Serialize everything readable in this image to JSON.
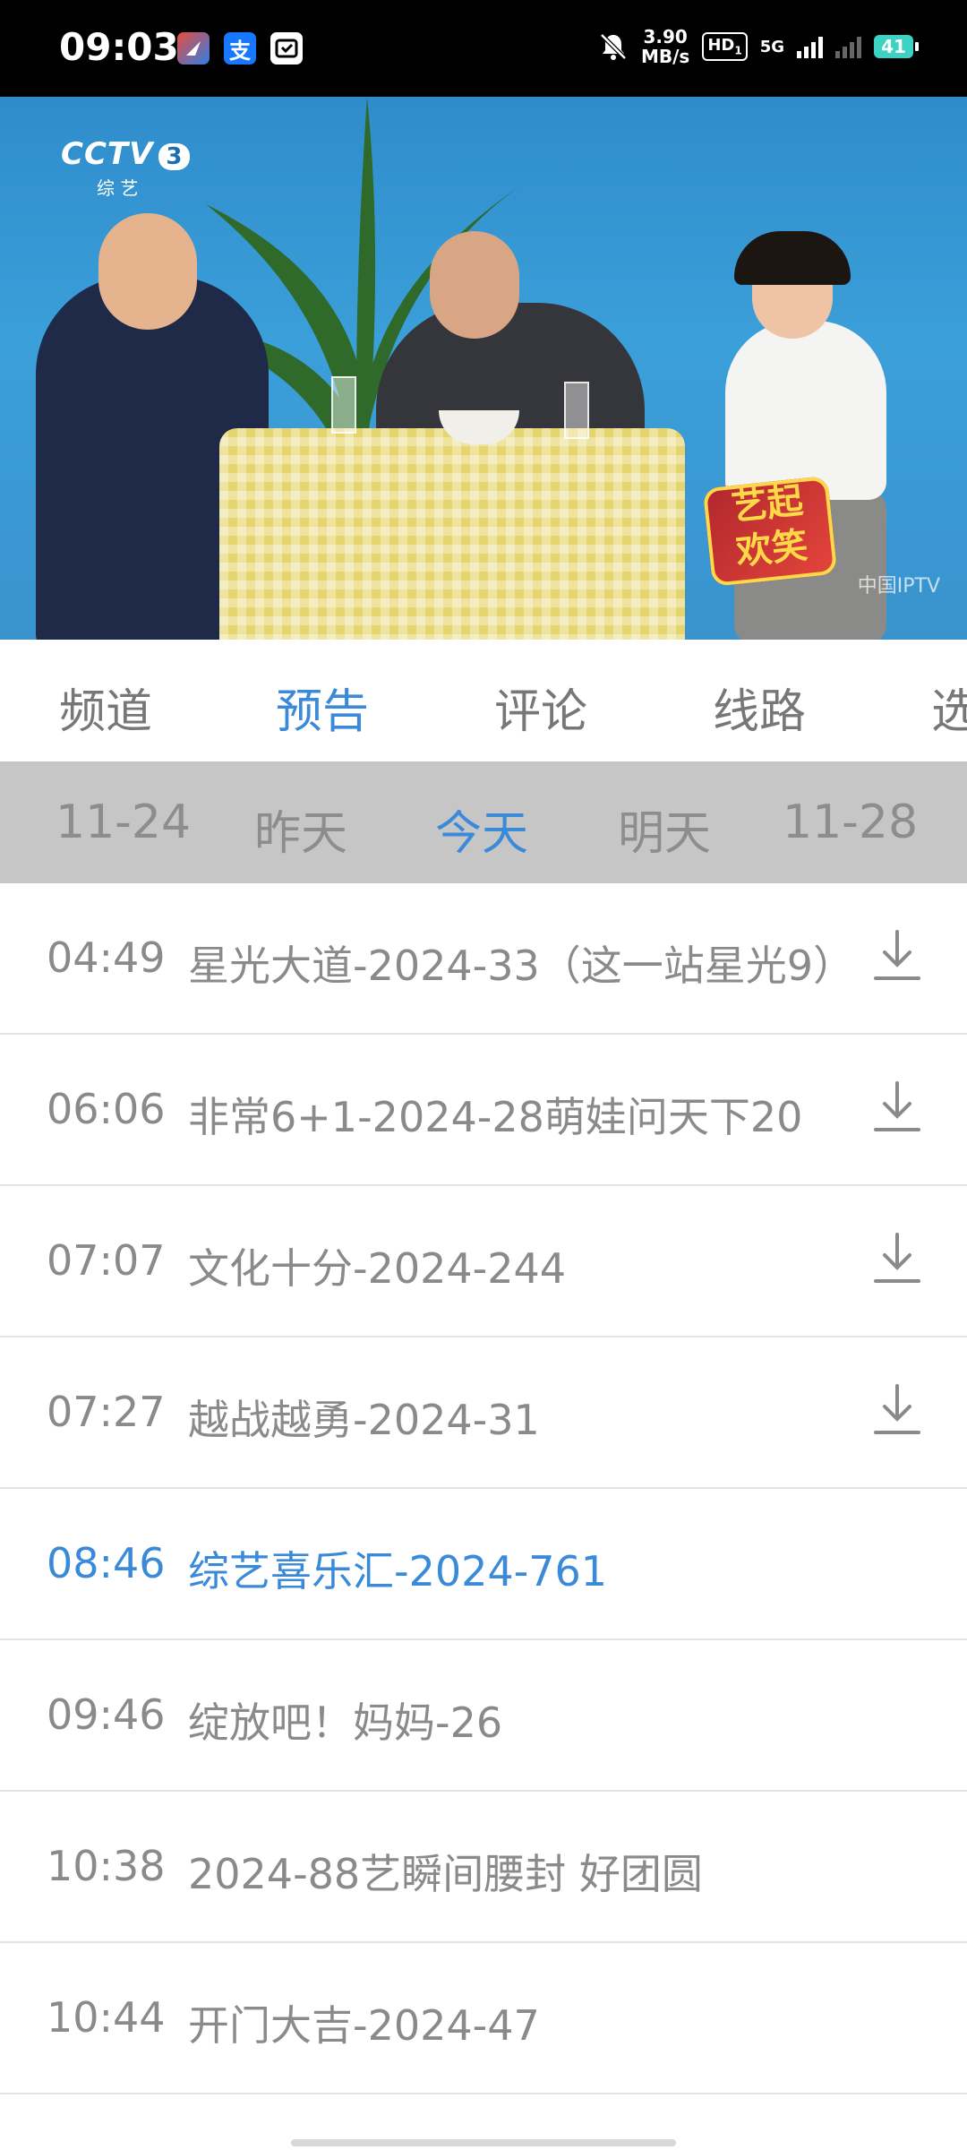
{
  "status_bar": {
    "time": "09:03",
    "net_speed_value": "3.90",
    "net_speed_unit": "MB/s",
    "hd": "HD",
    "hd_sub": "1",
    "network": "5G",
    "battery": "41",
    "app_icons": [
      "browser-app-icon",
      "alipay-app-icon",
      "wallet-app-icon"
    ],
    "app_icon_colors": [
      "#e84c3d",
      "#1677ff",
      "#ffffff"
    ],
    "alipay_glyph": "支"
  },
  "video": {
    "channel_logo": "CCTV",
    "channel_number": "3",
    "channel_name": "综 艺",
    "show_logo": "艺起\n欢笑",
    "watermark": "中国IPTV"
  },
  "tabs": [
    {
      "label": "频道",
      "active": false
    },
    {
      "label": "预告",
      "active": true
    },
    {
      "label": "评论",
      "active": false
    },
    {
      "label": "线路",
      "active": false
    },
    {
      "label": "选",
      "active": false
    }
  ],
  "dates": [
    {
      "label": "11-24",
      "active": false
    },
    {
      "label": "昨天",
      "active": false
    },
    {
      "label": "今天",
      "active": true
    },
    {
      "label": "明天",
      "active": false
    },
    {
      "label": "11-28",
      "active": false
    }
  ],
  "programs": [
    {
      "time": "04:49",
      "title": "星光大道-2024-33（这一站星光9）",
      "downloadable": true,
      "current": false
    },
    {
      "time": "06:06",
      "title": "非常6+1-2024-28萌娃问天下20",
      "downloadable": true,
      "current": false
    },
    {
      "time": "07:07",
      "title": "文化十分-2024-244",
      "downloadable": true,
      "current": false
    },
    {
      "time": "07:27",
      "title": "越战越勇-2024-31",
      "downloadable": true,
      "current": false
    },
    {
      "time": "08:46",
      "title": "综艺喜乐汇-2024-761",
      "downloadable": false,
      "current": true
    },
    {
      "time": "09:46",
      "title": "绽放吧！妈妈-26",
      "downloadable": false,
      "current": false
    },
    {
      "time": "10:38",
      "title": "2024-88艺瞬间腰封 好团圆",
      "downloadable": false,
      "current": false
    },
    {
      "time": "10:44",
      "title": "开门大吉-2024-47",
      "downloadable": false,
      "current": false
    }
  ],
  "colors": {
    "accent": "#3a8ad9",
    "inactive_text": "#8a8a8a",
    "date_strip_bg": "#c6c6c6"
  }
}
